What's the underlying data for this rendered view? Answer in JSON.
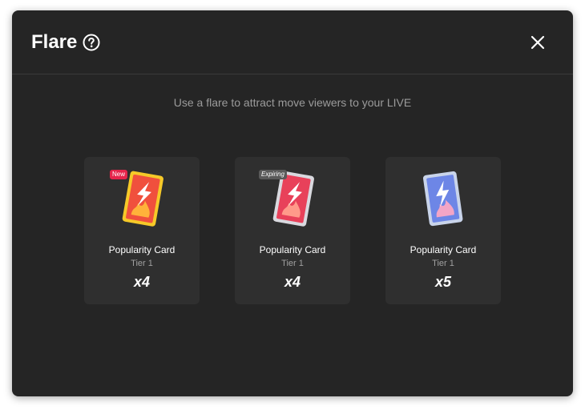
{
  "modal": {
    "title": "Flare",
    "subtitle": "Use a flare to attract move viewers to your LIVE"
  },
  "icons": {
    "help": "question-circle-icon",
    "close": "close-icon"
  },
  "colors": {
    "background": "#252525",
    "card_background": "#2f2f2f",
    "badge_new": "#e5254b",
    "badge_expiring": "#5a5a5a"
  },
  "cards": [
    {
      "name": "Popularity Card",
      "tier": "Tier 1",
      "count": "x4",
      "badge": "New",
      "style": "gold"
    },
    {
      "name": "Popularity Card",
      "tier": "Tier 1",
      "count": "x4",
      "badge": "Expiring",
      "style": "silver"
    },
    {
      "name": "Popularity Card",
      "tier": "Tier 1",
      "count": "x5",
      "badge": "",
      "style": "blue"
    }
  ]
}
